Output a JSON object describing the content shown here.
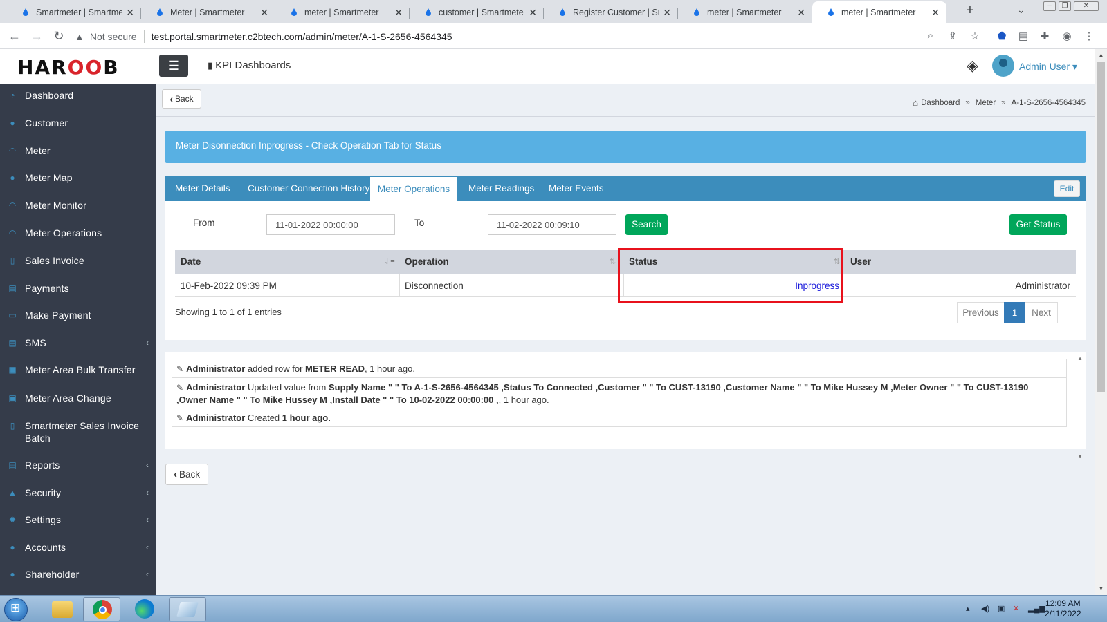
{
  "browser": {
    "tabs": [
      {
        "label": "Smartmeter | Smartmeter",
        "active": false
      },
      {
        "label": "Meter | Smartmeter",
        "active": false
      },
      {
        "label": "meter | Smartmeter",
        "active": false
      },
      {
        "label": "customer | Smartmeter",
        "active": false
      },
      {
        "label": "Register Customer | Smartmeter",
        "active": false
      },
      {
        "label": "meter | Smartmeter",
        "active": false
      },
      {
        "label": "meter | Smartmeter",
        "active": true
      }
    ],
    "not_secure": "Not secure",
    "url": "test.portal.smartmeter.c2btech.com/admin/meter/A-1-S-2656-4564345"
  },
  "header": {
    "logo_left": "HAR",
    "logo_mid": "OO",
    "logo_right": "B",
    "kpi_label": "KPI Dashboards",
    "user_name": "Admin User",
    "user_caret": "▾"
  },
  "sidebar": {
    "items": [
      {
        "label": "Dashboard",
        "icon": "pie-chart-icon",
        "glyph": "◔",
        "chevron": false
      },
      {
        "label": "Customer",
        "icon": "user-icon",
        "glyph": "●",
        "chevron": false
      },
      {
        "label": "Meter",
        "icon": "gauge-icon",
        "glyph": "◠",
        "chevron": false
      },
      {
        "label": "Meter Map",
        "icon": "map-marker-icon",
        "glyph": "●",
        "chevron": false
      },
      {
        "label": "Meter Monitor",
        "icon": "gauge-icon",
        "glyph": "◠",
        "chevron": false
      },
      {
        "label": "Meter Operations",
        "icon": "gauge-icon",
        "glyph": "◠",
        "chevron": false
      },
      {
        "label": "Sales Invoice",
        "icon": "file-icon",
        "glyph": "▯",
        "chevron": false
      },
      {
        "label": "Payments",
        "icon": "list-icon",
        "glyph": "▤",
        "chevron": false
      },
      {
        "label": "Make Payment",
        "icon": "credit-card-icon",
        "glyph": "▭",
        "chevron": false
      },
      {
        "label": "SMS",
        "icon": "list-icon",
        "glyph": "▤",
        "chevron": true
      },
      {
        "label": "Meter Area Bulk Transfer",
        "icon": "edit-icon",
        "glyph": "▣",
        "chevron": false
      },
      {
        "label": "Meter Area Change",
        "icon": "edit-icon",
        "glyph": "▣",
        "chevron": false
      },
      {
        "label": "Smartmeter Sales Invoice Batch",
        "icon": "file-icon",
        "glyph": "▯",
        "chevron": false
      },
      {
        "label": "Reports",
        "icon": "list-icon",
        "glyph": "▤",
        "chevron": true
      },
      {
        "label": "Security",
        "icon": "lock-icon",
        "glyph": "▲",
        "chevron": true
      },
      {
        "label": "Settings",
        "icon": "gear-icon",
        "glyph": "✹",
        "chevron": true
      },
      {
        "label": "Accounts",
        "icon": "bank-icon",
        "glyph": "●",
        "chevron": true
      },
      {
        "label": "Shareholder",
        "icon": "user-icon",
        "glyph": "●",
        "chevron": true
      }
    ],
    "chevron_glyph": "‹"
  },
  "main": {
    "back_label": "Back",
    "breadcrumb": {
      "home": "Dashboard",
      "meter": "Meter",
      "current": "A-1-S-2656-4564345",
      "separator": "»"
    },
    "alert_text": "Meter Disonnection Inprogress - Check Operation Tab for Status",
    "tabs": [
      {
        "label": "Meter Details"
      },
      {
        "label": "Customer Connection History"
      },
      {
        "label": "Meter Operations"
      },
      {
        "label": "Meter Readings"
      },
      {
        "label": "Meter Events"
      }
    ],
    "edit_label": "Edit",
    "filter": {
      "from_label": "From",
      "from_value": "11-01-2022 00:00:00",
      "to_label": "To",
      "to_value": "11-02-2022 00:09:10",
      "search_label": "Search",
      "get_status_label": "Get Status"
    },
    "table": {
      "headers": {
        "date": "Date",
        "operation": "Operation",
        "status": "Status",
        "user": "User"
      },
      "rows": [
        {
          "date": "10-Feb-2022 09:39 PM",
          "operation": "Disconnection",
          "status": "Inprogress",
          "user": "Administrator"
        }
      ],
      "showing": "Showing 1 to 1 of 1 entries",
      "pager": {
        "previous": "Previous",
        "page": "1",
        "next": "Next"
      }
    },
    "log": {
      "row1": {
        "who": "Administrator",
        "t1": " added row for ",
        "b1": "METER READ",
        "t2": ", 1 hour ago."
      },
      "row2": {
        "who": "Administrator",
        "t1": " Updated value from ",
        "b1": "Supply Name \" \" To A-1-S-2656-4564345 ,Status To Connected ,Customer \" \" To CUST-13190 ,Customer Name \" \" To Mike Hussey M ,Meter Owner \" \" To CUST-13190 ,Owner Name \" \" To Mike Hussey M ,Install Date \" \" To 10-02-2022 00:00:00 ,",
        "t2": ", 1 hour ago."
      },
      "row3": {
        "who": "Administrator",
        "t1": " Created ",
        "b1": "1 hour ago."
      }
    },
    "bottom_back_label": "Back"
  },
  "taskbar": {
    "time": "12:09 AM",
    "date": "2/11/2022"
  },
  "colors": {
    "brand_blue": "#3c8dbc",
    "alert_blue": "#58b0e3",
    "green": "#00a65a",
    "highlight_red": "#e8111c",
    "sidebar_bg": "#353c4a"
  }
}
